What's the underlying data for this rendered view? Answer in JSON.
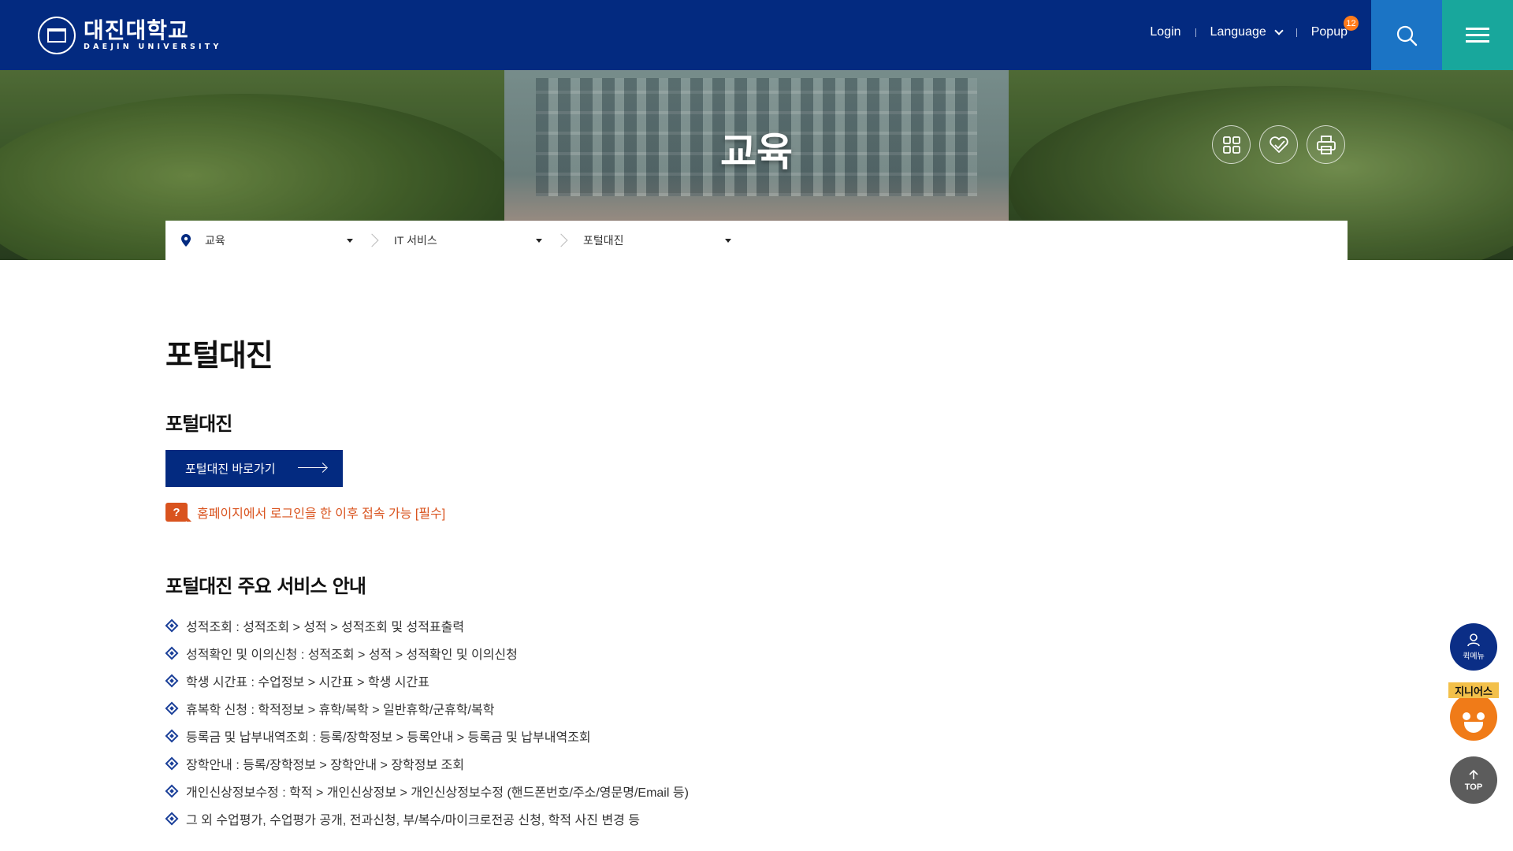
{
  "header": {
    "logo_ko": "대진대학교",
    "logo_en": "DAEJIN UNIVERSITY",
    "nav": {
      "login": "Login",
      "language": "Language",
      "popup": "Popup",
      "popup_count": "12"
    },
    "colors": {
      "bar": "#032a80",
      "search": "#1b74c5",
      "menu": "#18a79c"
    }
  },
  "hero": {
    "title": "교육",
    "tools": [
      "sitemap-icon",
      "share-icon",
      "print-icon"
    ]
  },
  "breadcrumb": {
    "icon": "location-pin-icon",
    "items": [
      {
        "label": "교육"
      },
      {
        "label": "IT 서비스"
      },
      {
        "label": "포털대진"
      }
    ]
  },
  "content": {
    "page_title": "포털대진",
    "section1_title": "포털대진",
    "go_button": "포털대진 바로가기",
    "notice_icon": "?",
    "notice_text": "홈페이지에서 로그인을 한 이후 접속 가능 [필수]",
    "section2_title": "포털대진 주요 서비스 안내",
    "services": [
      "성적조회 : 성적조회 > 성적 > 성적조회 및 성적표출력",
      "성적확인 및 이의신청 : 성적조회 > 성적 > 성적확인 및 이의신청",
      "학생 시간표 : 수업정보 > 시간표 > 학생 시간표",
      "휴복학 신청 : 학적정보 > 휴학/복학 > 일반휴학/군휴학/복학",
      "등록금 및 납부내역조회 : 등록/장학정보 > 등록안내 > 등록금 및 납부내역조회",
      "장학안내 : 등록/장학정보 > 장학안내 > 장학정보 조회",
      "개인신상정보수정 : 학적 > 개인신상정보 > 개인신상정보수정 (핸드폰번호/주소/영문명/Email 등)",
      "그 외 수업평가, 수업평가 공개, 전과신청, 부/복수/마이크로전공 신청, 학적 사진 변경 등"
    ]
  },
  "floating": {
    "quick_menu": "퀵메뉴",
    "chatbot": "지니어스",
    "top": "TOP"
  }
}
